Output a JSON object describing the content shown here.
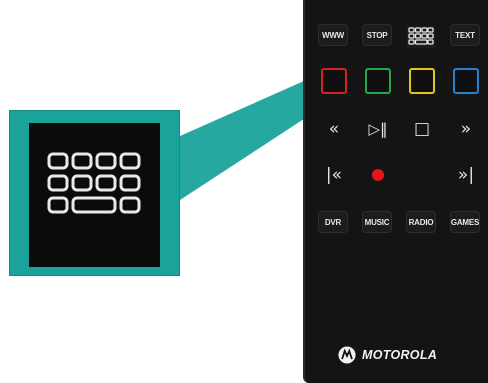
{
  "remote": {
    "row1": [
      "WWW",
      "STOP",
      "",
      "TEXT"
    ],
    "color_buttons": [
      {
        "name": "red",
        "color": "#d2232a"
      },
      {
        "name": "green",
        "color": "#24a64a"
      },
      {
        "name": "yellow",
        "color": "#e2c51d"
      },
      {
        "name": "blue",
        "color": "#2a7fd0"
      }
    ],
    "transport": [
      "«",
      "▷‖",
      "□",
      "»"
    ],
    "skip": [
      "|«",
      "»|"
    ],
    "record_color": "#e8141c",
    "row5": [
      "DVR",
      "MUSIC",
      "RADIO",
      "GAMES"
    ],
    "brand": "MOTOROLA"
  },
  "callout": {
    "icon": "keypad-icon",
    "frame_color": "#1aa39b"
  }
}
